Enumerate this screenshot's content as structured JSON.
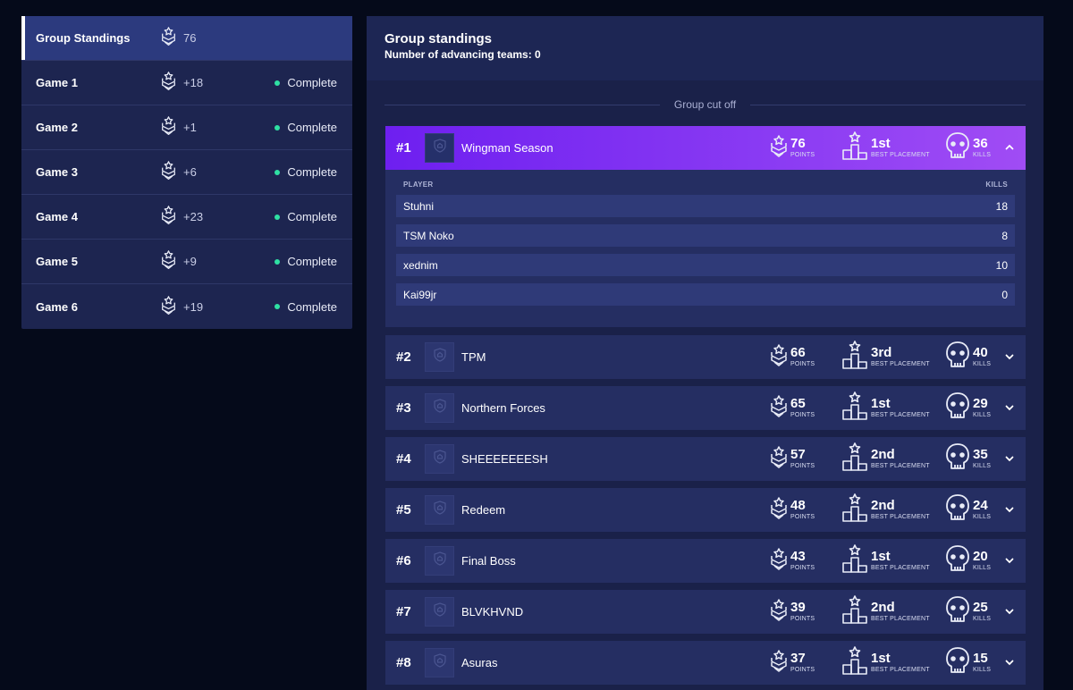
{
  "sidebar": {
    "items": [
      {
        "label": "Group Standings",
        "points": "76",
        "status": "",
        "active": true
      },
      {
        "label": "Game 1",
        "points": "+18",
        "status": "Complete",
        "active": false
      },
      {
        "label": "Game 2",
        "points": "+1",
        "status": "Complete",
        "active": false
      },
      {
        "label": "Game 3",
        "points": "+6",
        "status": "Complete",
        "active": false
      },
      {
        "label": "Game 4",
        "points": "+23",
        "status": "Complete",
        "active": false
      },
      {
        "label": "Game 5",
        "points": "+9",
        "status": "Complete",
        "active": false
      },
      {
        "label": "Game 6",
        "points": "+19",
        "status": "Complete",
        "active": false
      }
    ]
  },
  "main": {
    "title": "Group standings",
    "subtitle": "Number of advancing teams: 0",
    "cutoff_label": "Group cut off",
    "labels": {
      "points": "POINTS",
      "placement": "BEST PLACEMENT",
      "kills": "KILLS"
    },
    "player_table": {
      "player_header": "PLAYER",
      "kills_header": "KILLS"
    }
  },
  "teams": [
    {
      "rank": "#1",
      "name": "Wingman Season",
      "points": "76",
      "best_placement": "1st",
      "kills": "36",
      "expanded": true,
      "players": [
        {
          "name": "Stuhni",
          "kills": "18"
        },
        {
          "name": "TSM Noko",
          "kills": "8"
        },
        {
          "name": "xednim",
          "kills": "10"
        },
        {
          "name": "Kai99jr",
          "kills": "0"
        }
      ]
    },
    {
      "rank": "#2",
      "name": "TPM",
      "points": "66",
      "best_placement": "3rd",
      "kills": "40",
      "expanded": false
    },
    {
      "rank": "#3",
      "name": "Northern Forces",
      "points": "65",
      "best_placement": "1st",
      "kills": "29",
      "expanded": false
    },
    {
      "rank": "#4",
      "name": "SHEEEEEEESH",
      "points": "57",
      "best_placement": "2nd",
      "kills": "35",
      "expanded": false
    },
    {
      "rank": "#5",
      "name": "Redeem",
      "points": "48",
      "best_placement": "2nd",
      "kills": "24",
      "expanded": false
    },
    {
      "rank": "#6",
      "name": "Final Boss",
      "points": "43",
      "best_placement": "1st",
      "kills": "20",
      "expanded": false
    },
    {
      "rank": "#7",
      "name": "BLVKHVND",
      "points": "39",
      "best_placement": "2nd",
      "kills": "25",
      "expanded": false
    },
    {
      "rank": "#8",
      "name": "Asuras",
      "points": "37",
      "best_placement": "1st",
      "kills": "15",
      "expanded": false
    }
  ],
  "icons": {
    "points": "chevron-rank-icon",
    "placement": "podium-icon",
    "kills": "skull-icon",
    "logo": "shield-icon",
    "collapse": "chevron-up-icon",
    "expand": "chevron-down-icon"
  },
  "colors": {
    "accent_gradient_start": "#6e1ff0",
    "accent_gradient_end": "#a04cf4",
    "status_complete": "#2fe0a3"
  }
}
